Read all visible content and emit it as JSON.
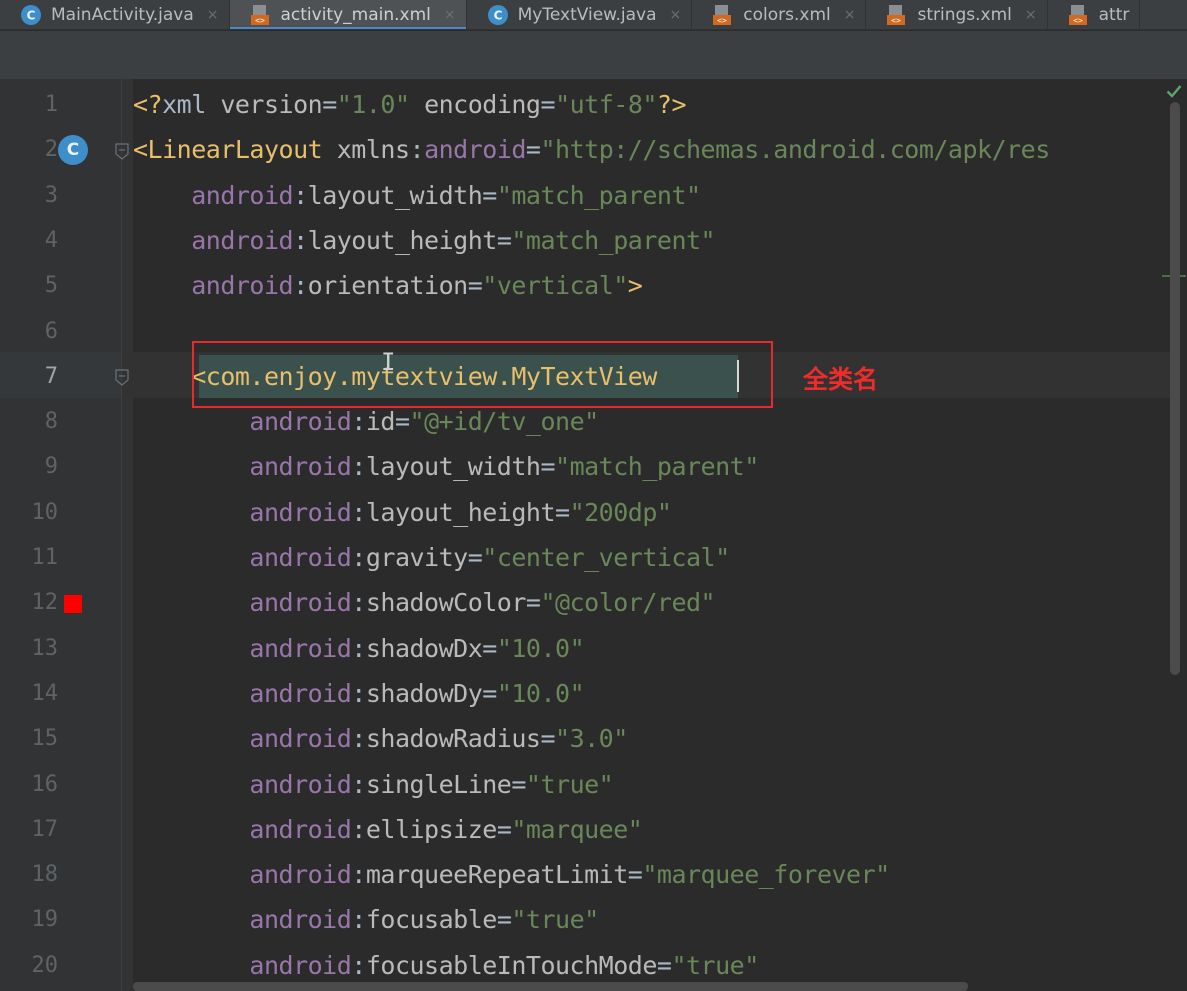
{
  "tabs": [
    {
      "label": "MainActivity.java",
      "icon": "java-class-icon",
      "active": false
    },
    {
      "label": "activity_main.xml",
      "icon": "xml-file-icon",
      "active": true
    },
    {
      "label": "MyTextView.java",
      "icon": "java-class-icon",
      "active": false
    },
    {
      "label": "colors.xml",
      "icon": "xml-file-icon",
      "active": false
    },
    {
      "label": "strings.xml",
      "icon": "xml-file-icon",
      "active": false
    },
    {
      "label": "attr",
      "icon": "xml-file-icon",
      "active": false
    }
  ],
  "tab_close_glyph": "×",
  "gutter": {
    "class_marker": "C",
    "color_marker_color": "#ff0000"
  },
  "editor": {
    "current_line": 7,
    "cursor_char": "I",
    "lines": [
      {
        "number": "1",
        "tokens": [
          {
            "t": "<?",
            "c": "punct"
          },
          {
            "t": "xml ",
            "c": "plain"
          },
          {
            "t": "version",
            "c": "attr"
          },
          {
            "t": "=",
            "c": "eq"
          },
          {
            "t": "\"1.0\"",
            "c": "val"
          },
          {
            "t": " ",
            "c": "plain"
          },
          {
            "t": "encoding",
            "c": "attr"
          },
          {
            "t": "=",
            "c": "eq"
          },
          {
            "t": "\"utf-8\"",
            "c": "val"
          },
          {
            "t": "?>",
            "c": "punct"
          }
        ]
      },
      {
        "number": "2",
        "tokens": [
          {
            "t": "<LinearLayout",
            "c": "tag"
          },
          {
            "t": " ",
            "c": "plain"
          },
          {
            "t": "xmlns",
            "c": "attr"
          },
          {
            "t": ":",
            "c": "eq"
          },
          {
            "t": "android",
            "c": "ns"
          },
          {
            "t": "=",
            "c": "eq"
          },
          {
            "t": "\"http://schemas.android.com/apk/res",
            "c": "val"
          }
        ]
      },
      {
        "number": "3",
        "tokens": [
          {
            "t": "    ",
            "c": "plain"
          },
          {
            "t": "android",
            "c": "ns"
          },
          {
            "t": ":",
            "c": "eq"
          },
          {
            "t": "layout_width",
            "c": "attr"
          },
          {
            "t": "=",
            "c": "eq"
          },
          {
            "t": "\"match_parent\"",
            "c": "val"
          }
        ]
      },
      {
        "number": "4",
        "tokens": [
          {
            "t": "    ",
            "c": "plain"
          },
          {
            "t": "android",
            "c": "ns"
          },
          {
            "t": ":",
            "c": "eq"
          },
          {
            "t": "layout_height",
            "c": "attr"
          },
          {
            "t": "=",
            "c": "eq"
          },
          {
            "t": "\"match_parent\"",
            "c": "val"
          }
        ]
      },
      {
        "number": "5",
        "tokens": [
          {
            "t": "    ",
            "c": "plain"
          },
          {
            "t": "android",
            "c": "ns"
          },
          {
            "t": ":",
            "c": "eq"
          },
          {
            "t": "orientation",
            "c": "attr"
          },
          {
            "t": "=",
            "c": "eq"
          },
          {
            "t": "\"vertical\"",
            "c": "val"
          },
          {
            "t": ">",
            "c": "tag"
          }
        ]
      },
      {
        "number": "6",
        "tokens": []
      },
      {
        "number": "7",
        "tokens": [
          {
            "t": "    ",
            "c": "plain"
          },
          {
            "t": "<com.enjoy.mytextview.MyTextView",
            "c": "tag"
          }
        ]
      },
      {
        "number": "8",
        "tokens": [
          {
            "t": "        ",
            "c": "plain"
          },
          {
            "t": "android",
            "c": "ns"
          },
          {
            "t": ":",
            "c": "eq"
          },
          {
            "t": "id",
            "c": "attr"
          },
          {
            "t": "=",
            "c": "eq"
          },
          {
            "t": "\"@+id/tv_one\"",
            "c": "val"
          }
        ]
      },
      {
        "number": "9",
        "tokens": [
          {
            "t": "        ",
            "c": "plain"
          },
          {
            "t": "android",
            "c": "ns"
          },
          {
            "t": ":",
            "c": "eq"
          },
          {
            "t": "layout_width",
            "c": "attr"
          },
          {
            "t": "=",
            "c": "eq"
          },
          {
            "t": "\"match_parent\"",
            "c": "val"
          }
        ]
      },
      {
        "number": "10",
        "tokens": [
          {
            "t": "        ",
            "c": "plain"
          },
          {
            "t": "android",
            "c": "ns"
          },
          {
            "t": ":",
            "c": "eq"
          },
          {
            "t": "layout_height",
            "c": "attr"
          },
          {
            "t": "=",
            "c": "eq"
          },
          {
            "t": "\"200dp\"",
            "c": "val"
          }
        ]
      },
      {
        "number": "11",
        "tokens": [
          {
            "t": "        ",
            "c": "plain"
          },
          {
            "t": "android",
            "c": "ns"
          },
          {
            "t": ":",
            "c": "eq"
          },
          {
            "t": "gravity",
            "c": "attr"
          },
          {
            "t": "=",
            "c": "eq"
          },
          {
            "t": "\"center_vertical\"",
            "c": "val"
          }
        ]
      },
      {
        "number": "12",
        "tokens": [
          {
            "t": "        ",
            "c": "plain"
          },
          {
            "t": "android",
            "c": "ns"
          },
          {
            "t": ":",
            "c": "eq"
          },
          {
            "t": "shadowColor",
            "c": "attr"
          },
          {
            "t": "=",
            "c": "eq"
          },
          {
            "t": "\"@color/red\"",
            "c": "val"
          }
        ]
      },
      {
        "number": "13",
        "tokens": [
          {
            "t": "        ",
            "c": "plain"
          },
          {
            "t": "android",
            "c": "ns"
          },
          {
            "t": ":",
            "c": "eq"
          },
          {
            "t": "shadowDx",
            "c": "attr"
          },
          {
            "t": "=",
            "c": "eq"
          },
          {
            "t": "\"10.0\"",
            "c": "val"
          }
        ]
      },
      {
        "number": "14",
        "tokens": [
          {
            "t": "        ",
            "c": "plain"
          },
          {
            "t": "android",
            "c": "ns"
          },
          {
            "t": ":",
            "c": "eq"
          },
          {
            "t": "shadowDy",
            "c": "attr"
          },
          {
            "t": "=",
            "c": "eq"
          },
          {
            "t": "\"10.0\"",
            "c": "val"
          }
        ]
      },
      {
        "number": "15",
        "tokens": [
          {
            "t": "        ",
            "c": "plain"
          },
          {
            "t": "android",
            "c": "ns"
          },
          {
            "t": ":",
            "c": "eq"
          },
          {
            "t": "shadowRadius",
            "c": "attr"
          },
          {
            "t": "=",
            "c": "eq"
          },
          {
            "t": "\"3.0\"",
            "c": "val"
          }
        ]
      },
      {
        "number": "16",
        "tokens": [
          {
            "t": "        ",
            "c": "plain"
          },
          {
            "t": "android",
            "c": "ns"
          },
          {
            "t": ":",
            "c": "eq"
          },
          {
            "t": "singleLine",
            "c": "attr"
          },
          {
            "t": "=",
            "c": "eq"
          },
          {
            "t": "\"true\"",
            "c": "val"
          }
        ]
      },
      {
        "number": "17",
        "tokens": [
          {
            "t": "        ",
            "c": "plain"
          },
          {
            "t": "android",
            "c": "ns"
          },
          {
            "t": ":",
            "c": "eq"
          },
          {
            "t": "ellipsize",
            "c": "attr"
          },
          {
            "t": "=",
            "c": "eq"
          },
          {
            "t": "\"marquee\"",
            "c": "val"
          }
        ]
      },
      {
        "number": "18",
        "tokens": [
          {
            "t": "        ",
            "c": "plain"
          },
          {
            "t": "android",
            "c": "ns"
          },
          {
            "t": ":",
            "c": "eq"
          },
          {
            "t": "marqueeRepeatLimit",
            "c": "attr"
          },
          {
            "t": "=",
            "c": "eq"
          },
          {
            "t": "\"marquee_forever\"",
            "c": "val"
          }
        ]
      },
      {
        "number": "19",
        "tokens": [
          {
            "t": "        ",
            "c": "plain"
          },
          {
            "t": "android",
            "c": "ns"
          },
          {
            "t": ":",
            "c": "eq"
          },
          {
            "t": "focusable",
            "c": "attr"
          },
          {
            "t": "=",
            "c": "eq"
          },
          {
            "t": "\"true\"",
            "c": "val"
          }
        ]
      },
      {
        "number": "20",
        "tokens": [
          {
            "t": "        ",
            "c": "plain"
          },
          {
            "t": "android",
            "c": "ns"
          },
          {
            "t": ":",
            "c": "eq"
          },
          {
            "t": "focusableInTouchMode",
            "c": "attr"
          },
          {
            "t": "=",
            "c": "eq"
          },
          {
            "t": "\"true\"",
            "c": "val"
          }
        ]
      }
    ]
  },
  "annotation": {
    "label": "全类名",
    "color": "#e52b2b"
  },
  "colors": {
    "editor_bg": "#2b2b2b",
    "tag": "#e8bf6a",
    "namespace": "#9876aa",
    "attribute": "#bababa",
    "value": "#6a8759",
    "tab_active_underline": "#4a88c7"
  }
}
